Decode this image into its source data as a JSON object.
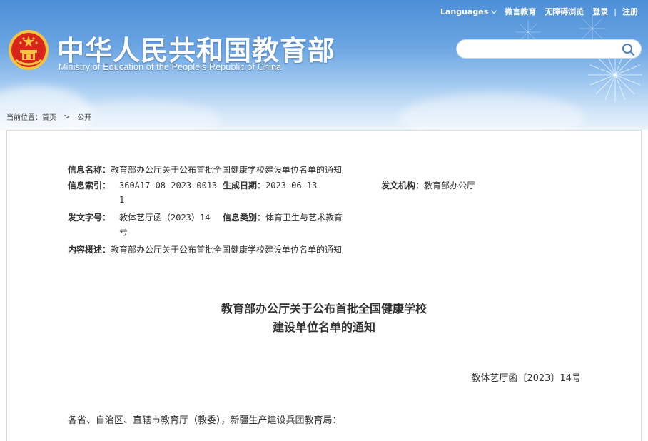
{
  "topbar": {
    "languages": "Languages",
    "weibo": "微言教育",
    "accessibility": "无障碍浏览",
    "login": "登录",
    "separator": "|",
    "register": "注册"
  },
  "header": {
    "title_cn": "中华人民共和国教育部",
    "title_en": "Ministry of Education of the People's Republic of China",
    "search_placeholder": ""
  },
  "breadcrumb": {
    "prefix": "当前位置：",
    "items": [
      "首页",
      "公开"
    ],
    "arrow": ">"
  },
  "meta": {
    "name_label": "信息名称：",
    "name_value": "教育部办公厅关于公布首批全国健康学校建设单位名单的通知",
    "index_label": "信息索引：",
    "index_value_line1": "360A17-08-2023-0013-",
    "index_value_line2": "1",
    "date_label": "生成日期：",
    "date_value": "2023-06-13",
    "issuer_label": "发文机构：",
    "issuer_value": "教育部办公厅",
    "docno_label": "发文字号：",
    "docno_value_line1": "教体艺厅函（2023）14",
    "docno_value_line2": "号",
    "category_label": "信息类别：",
    "category_value": "体育卫生与艺术教育",
    "summary_label": "内容概述：",
    "summary_value": "教育部办公厅关于公布首批全国健康学校建设单位名单的通知"
  },
  "document": {
    "title_line1": "教育部办公厅关于公布首批全国健康学校",
    "title_line2": "建设单位名单的通知",
    "doc_number": "教体艺厅函〔2023〕14号",
    "salutation": "各省、自治区、直辖市教育厅（教委），新疆生产建设兵团教育局："
  },
  "colors": {
    "header_top": "#4d8fd8",
    "header_bottom": "#e9f3fc",
    "emblem_red": "#d9261c",
    "emblem_gold": "#f6c243"
  }
}
